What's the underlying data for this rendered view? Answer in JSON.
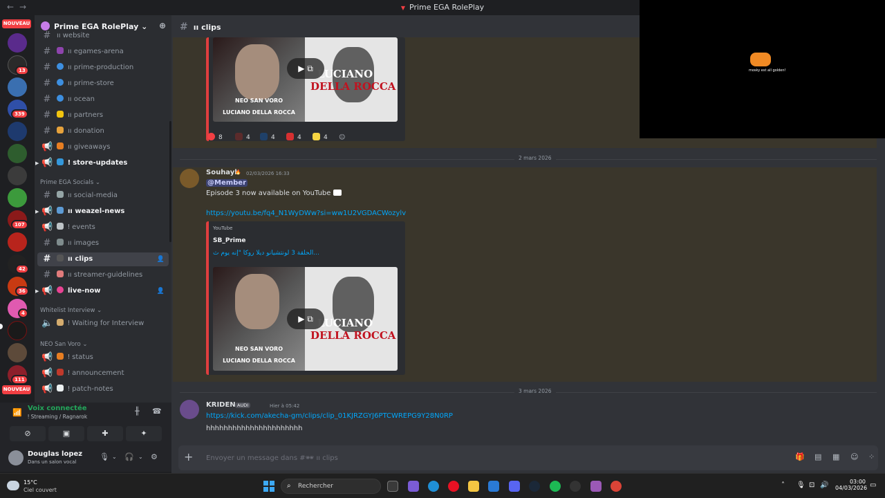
{
  "window": {
    "title": "Prime EGA RolePlay",
    "nav_back": "←",
    "nav_forward": "→"
  },
  "rail": {
    "new_label": "NOUVEAU",
    "badges": [
      "13",
      "339",
      "107",
      "42",
      "36",
      "4",
      "111"
    ]
  },
  "guild": {
    "name": "Prime EGA RolePlay ⌄"
  },
  "channels": [
    {
      "name": "ıı website"
    },
    {
      "name": "ıı egames-arena"
    },
    {
      "name": "ıı prime-production"
    },
    {
      "name": "ıı prime-store"
    },
    {
      "name": "ıı ocean"
    },
    {
      "name": "ıı partners"
    },
    {
      "name": "ıı donation"
    },
    {
      "name": "ıı giveaways"
    },
    {
      "name": "ǃ store-updates"
    }
  ],
  "categories": {
    "socials": "Prime EGA Socials ⌄",
    "whitelist": "Whitelist Interview ⌄",
    "neo": "NEO San Voro ⌄"
  },
  "social_channels": [
    {
      "name": "ıı social-media"
    },
    {
      "name": "ıı weazel-news"
    },
    {
      "name": "ǃ events"
    },
    {
      "name": "ıı images"
    },
    {
      "name": "ıı clips"
    },
    {
      "name": "ıı streamer-guidelines"
    },
    {
      "name": "live-now"
    }
  ],
  "whitelist_channels": [
    {
      "name": "ǃ Waiting for Interview"
    }
  ],
  "neo_channels": [
    {
      "name": "ǃ status"
    },
    {
      "name": "ǃ announcement"
    },
    {
      "name": "ǃ patch-notes"
    }
  ],
  "voice": {
    "title": "Voix connectée",
    "subtitle": "ǃ Streaming / Ragnarok"
  },
  "user": {
    "name": "Douglas lopez",
    "status": "Dans un salon vocal"
  },
  "header": {
    "channel": "ıı clips"
  },
  "thumbnail": {
    "left_caption_1": "NEO SAN VORO",
    "left_caption_2": "LUCIANO DELLA ROCCA",
    "title_1": "LUCIANO",
    "title_2": "DELLA ROCCA"
  },
  "reactions": [
    "8",
    "4",
    "4",
    "4",
    "4"
  ],
  "dividers": [
    "2 mars 2026",
    "3 mars 2026"
  ],
  "message1": {
    "author": "Souhayb",
    "timestamp": "02/03/2026 16:33",
    "mention": "@Member",
    "text": "Episode 3 now available on YouTube",
    "link": "https://youtu.be/fq4_N1WyDWw?si=ww1U2VGDACWozylv",
    "embed_provider": "YouTube",
    "embed_author": "SB_Prime",
    "embed_title": "الحلقة 3 لونتشيانو ديلا روكا \"إنه يوم ث..."
  },
  "message2": {
    "author": "KRIDEN",
    "tag": "AUDI",
    "timestamp": "Hier à 05:42",
    "link": "https://kick.com/akecha-gm/clips/clip_01KJRZGYJ6PTCWREPG9Y28N0RP",
    "text": "hhhhhhhhhhhhhhhhhhhhhh"
  },
  "composer": {
    "placeholder": "Envoyer un message dans #🕶 ıı clips"
  },
  "overlay": {
    "caption": "mosky est all golden!"
  },
  "taskbar": {
    "temp": "15°C",
    "condition": "Ciel couvert",
    "search": "Rechercher",
    "time": "03:00",
    "date": "04/03/2026"
  },
  "colors": {
    "accent": "#5865f2",
    "online": "#23a55a",
    "badge": "#f23f43",
    "link": "#00a8fc",
    "highlight": "#3a362b"
  }
}
